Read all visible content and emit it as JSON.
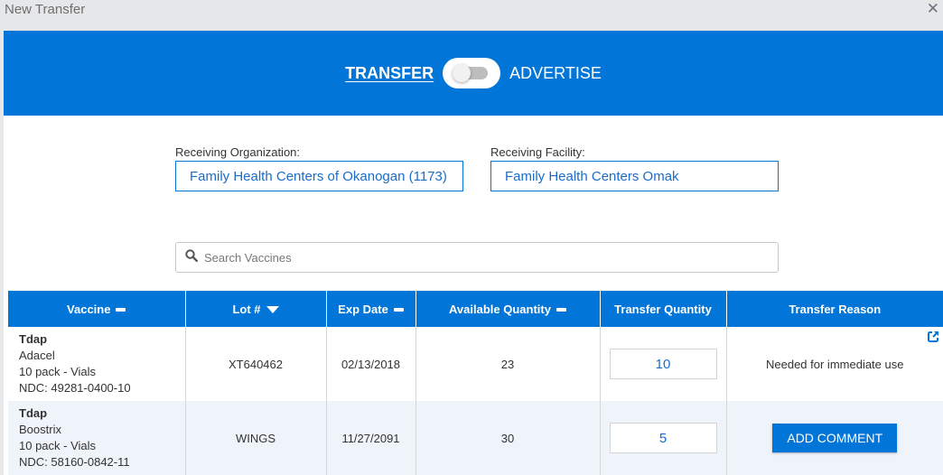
{
  "dialog": {
    "title": "New Transfer",
    "close_icon": "close-icon"
  },
  "mode_toggle": {
    "left_label": "TRANSFER",
    "right_label": "ADVERTISE",
    "selected": "TRANSFER"
  },
  "receiving_org": {
    "label": "Receiving Organization:",
    "value": "Family Health Centers of Okanogan (1173)"
  },
  "receiving_facility": {
    "label": "Receiving Facility:",
    "value": "Family Health Centers Omak"
  },
  "search": {
    "placeholder": "Search Vaccines",
    "value": "",
    "icon": "search-icon"
  },
  "table": {
    "columns": [
      {
        "label": "Vaccine",
        "sort_icon": "minus-icon"
      },
      {
        "label": "Lot #",
        "sort_icon": "caret-down-icon"
      },
      {
        "label": "Exp Date",
        "sort_icon": "minus-icon"
      },
      {
        "label": "Available Quantity",
        "sort_icon": "minus-icon"
      },
      {
        "label": "Transfer Quantity",
        "sort_icon": ""
      },
      {
        "label": "Transfer Reason",
        "sort_icon": ""
      }
    ],
    "rows": [
      {
        "vaccine": "Tdap",
        "brand": "Adacel",
        "pack": "10 pack - Vials",
        "ndc": "NDC: 49281-0400-10",
        "lot": "XT640462",
        "exp_date": "02/13/2018",
        "available_qty": "23",
        "transfer_qty": "10",
        "reason": "Needed for immediate use",
        "edit_icon": "external-edit-icon"
      },
      {
        "vaccine": "Tdap",
        "brand": "Boostrix",
        "pack": "10 pack - Vials",
        "ndc": "NDC: 58160-0842-11",
        "lot": "WINGS",
        "exp_date": "11/27/2091",
        "available_qty": "30",
        "transfer_qty": "5",
        "reason_button": "ADD COMMENT"
      }
    ]
  },
  "colors": {
    "primary": "#0175d8",
    "link_text": "#1a6cc8",
    "alt_row": "#eff3fa"
  }
}
